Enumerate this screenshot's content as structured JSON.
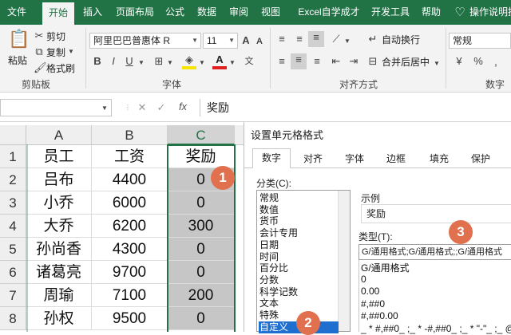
{
  "ribbon_tabs": [
    "文件",
    "开始",
    "插入",
    "页面布局",
    "公式",
    "数据",
    "审阅",
    "视图",
    "Excel自学成才",
    "开发工具",
    "帮助",
    "操作说明搜"
  ],
  "clipboard": {
    "paste": "粘贴",
    "cut": "剪切",
    "copy": "复制",
    "format_painter": "格式刷",
    "group": "剪贴板"
  },
  "font": {
    "name": "阿里巴巴普惠体 R",
    "size": "11",
    "group": "字体",
    "bold": "B",
    "italic": "I",
    "underline": "U"
  },
  "alignment": {
    "wrap_text": "自动换行",
    "merge_center": "合并后居中",
    "group": "对齐方式"
  },
  "number": {
    "format": "常规",
    "group": "数字"
  },
  "formula_bar": {
    "fx": "fx",
    "cancel": "✕",
    "enter": "✓",
    "content": "奖励"
  },
  "sheet": {
    "columns": [
      "A",
      "B",
      "C"
    ],
    "rows": [
      {
        "num": "1",
        "a": "员工",
        "b": "工资",
        "c": "奖励"
      },
      {
        "num": "2",
        "a": "吕布",
        "b": "4400",
        "c": "0"
      },
      {
        "num": "3",
        "a": "小乔",
        "b": "6000",
        "c": "0"
      },
      {
        "num": "4",
        "a": "大乔",
        "b": "6200",
        "c": "300"
      },
      {
        "num": "5",
        "a": "孙尚香",
        "b": "4300",
        "c": "0"
      },
      {
        "num": "6",
        "a": "诸葛亮",
        "b": "9700",
        "c": "0"
      },
      {
        "num": "7",
        "a": "周瑜",
        "b": "7100",
        "c": "200"
      },
      {
        "num": "8",
        "a": "孙权",
        "b": "9500",
        "c": "0"
      }
    ]
  },
  "dialog": {
    "title": "设置单元格格式",
    "tabs": [
      "数字",
      "对齐",
      "字体",
      "边框",
      "填充",
      "保护"
    ],
    "category_label": "分类(C):",
    "categories": [
      "常规",
      "数值",
      "货币",
      "会计专用",
      "日期",
      "时间",
      "百分比",
      "分数",
      "科学记数",
      "文本",
      "特殊",
      "自定义"
    ],
    "selected_category": "自定义",
    "sample_label": "示例",
    "sample_value": "奖励",
    "type_label": "类型(T):",
    "type_value": "G/通用格式;G/通用格式;;G/通用格式",
    "type_list": [
      "G/通用格式",
      "0",
      "0.00",
      "#,##0",
      "#,##0.00",
      "_ * #,##0_ ;_ * -#,##0_ ;_ * \"-\"_ ;_ @"
    ]
  },
  "badges": [
    "1",
    "2",
    "3"
  ],
  "colors": {
    "excel_green": "#217346",
    "badge": "#e0704e",
    "selection": "#1f6fd1",
    "selected_cells": "#c6c6c6"
  }
}
